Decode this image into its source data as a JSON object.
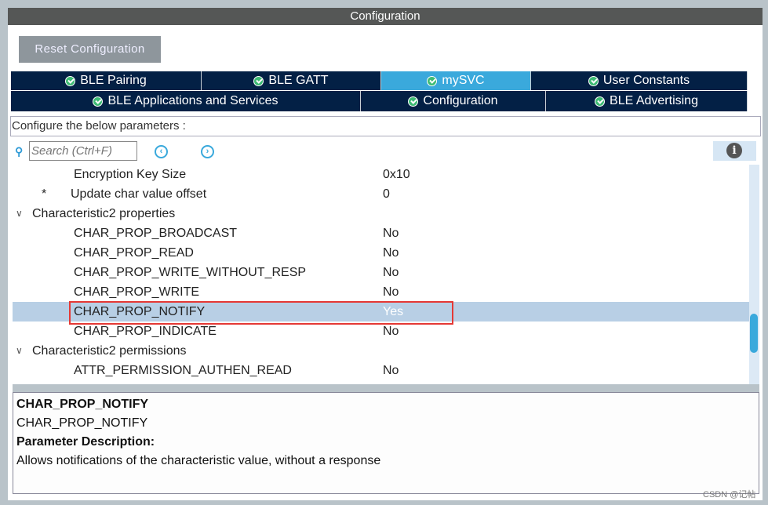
{
  "window": {
    "title": "Configuration"
  },
  "toolbar": {
    "reset_label": "Reset Configuration"
  },
  "tabs_row1": [
    {
      "label": "BLE Pairing"
    },
    {
      "label": "BLE GATT"
    },
    {
      "label": "mySVC",
      "active": true
    },
    {
      "label": "User Constants"
    }
  ],
  "tabs_row2": [
    {
      "label": "BLE Applications and Services"
    },
    {
      "label": "Configuration"
    },
    {
      "label": "BLE Advertising"
    }
  ],
  "configure_text": "Configure the below parameters :",
  "search": {
    "placeholder": "Search (Ctrl+F)"
  },
  "params": [
    {
      "name": "Encryption Key Size",
      "value": "0x10"
    },
    {
      "name": "Update char value offset",
      "value": "0",
      "marker": "*"
    },
    {
      "name": "Characteristic2 properties",
      "group": true
    },
    {
      "name": "CHAR_PROP_BROADCAST",
      "value": "No"
    },
    {
      "name": "CHAR_PROP_READ",
      "value": "No"
    },
    {
      "name": "CHAR_PROP_WRITE_WITHOUT_RESP",
      "value": "No"
    },
    {
      "name": "CHAR_PROP_WRITE",
      "value": "No"
    },
    {
      "name": "CHAR_PROP_NOTIFY",
      "value": "Yes",
      "selected": true
    },
    {
      "name": "CHAR_PROP_INDICATE",
      "value": "No"
    },
    {
      "name": "Characteristic2 permissions",
      "group": true
    },
    {
      "name": "ATTR_PERMISSION_AUTHEN_READ",
      "value": "No"
    }
  ],
  "description": {
    "title": "CHAR_PROP_NOTIFY",
    "subtitle": "CHAR_PROP_NOTIFY",
    "heading": "Parameter Description:",
    "text": "Allows notifications of the characteristic value, without a response"
  },
  "watermark": "CSDN @记帖"
}
